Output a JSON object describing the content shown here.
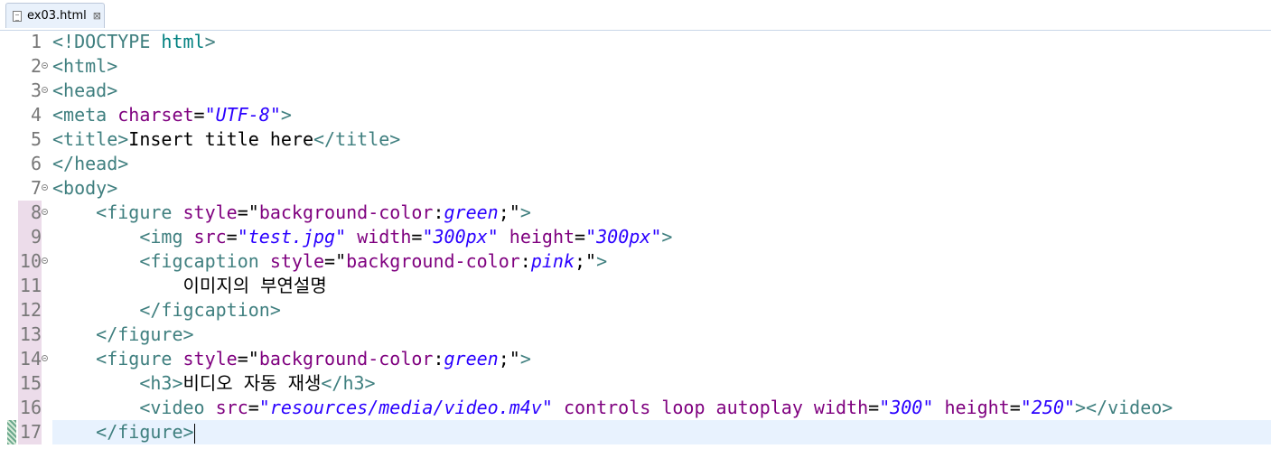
{
  "tab": {
    "title": "ex03.html",
    "close_glyph": "⊠"
  },
  "lines": [
    {
      "n": "1",
      "tokens": [
        [
          "t",
          "<!DOCTYPE "
        ],
        [
          "kw",
          "html"
        ],
        [
          "t",
          ">"
        ]
      ]
    },
    {
      "n": "2",
      "fold": true,
      "tokens": [
        [
          "t",
          "<html>"
        ]
      ]
    },
    {
      "n": "3",
      "fold": true,
      "tokens": [
        [
          "t",
          "<head>"
        ]
      ]
    },
    {
      "n": "4",
      "tokens": [
        [
          "t",
          "<meta "
        ],
        [
          "a",
          "charset"
        ],
        [
          "s",
          "="
        ],
        [
          "v",
          "\"UTF-8\""
        ],
        [
          "t",
          ">"
        ]
      ]
    },
    {
      "n": "5",
      "tokens": [
        [
          "t",
          "<title>"
        ],
        [
          "s",
          "Insert title here"
        ],
        [
          "t",
          "</title>"
        ]
      ]
    },
    {
      "n": "6",
      "tokens": [
        [
          "t",
          "</head>"
        ]
      ]
    },
    {
      "n": "7",
      "fold": true,
      "tokens": [
        [
          "t",
          "<body>"
        ]
      ]
    },
    {
      "n": "8",
      "fold": true,
      "mark": true,
      "tokens": [
        [
          "s",
          "    "
        ],
        [
          "t",
          "<figure "
        ],
        [
          "a",
          "style"
        ],
        [
          "s",
          "=\""
        ],
        [
          "a",
          "background-color"
        ],
        [
          "s",
          ":"
        ],
        [
          "v",
          "green"
        ],
        [
          "s",
          ";\""
        ],
        [
          "t",
          ">"
        ]
      ]
    },
    {
      "n": "9",
      "mark": true,
      "tokens": [
        [
          "s",
          "        "
        ],
        [
          "t",
          "<img "
        ],
        [
          "a",
          "src"
        ],
        [
          "s",
          "="
        ],
        [
          "v",
          "\"test.jpg\""
        ],
        [
          "s",
          " "
        ],
        [
          "a",
          "width"
        ],
        [
          "s",
          "="
        ],
        [
          "v",
          "\"300px\""
        ],
        [
          "s",
          " "
        ],
        [
          "a",
          "height"
        ],
        [
          "s",
          "="
        ],
        [
          "v",
          "\"300px\""
        ],
        [
          "t",
          ">"
        ]
      ]
    },
    {
      "n": "10",
      "fold": true,
      "mark": true,
      "tokens": [
        [
          "s",
          "        "
        ],
        [
          "t",
          "<figcaption "
        ],
        [
          "a",
          "style"
        ],
        [
          "s",
          "=\""
        ],
        [
          "a",
          "background-color"
        ],
        [
          "s",
          ":"
        ],
        [
          "v",
          "pink"
        ],
        [
          "s",
          ";\""
        ],
        [
          "t",
          ">"
        ]
      ]
    },
    {
      "n": "11",
      "mark": true,
      "tokens": [
        [
          "s",
          "            이미지의 부연설명"
        ]
      ]
    },
    {
      "n": "12",
      "mark": true,
      "tokens": [
        [
          "s",
          "        "
        ],
        [
          "t",
          "</figcaption>"
        ]
      ]
    },
    {
      "n": "13",
      "mark": true,
      "tokens": [
        [
          "s",
          "    "
        ],
        [
          "t",
          "</figure>"
        ]
      ]
    },
    {
      "n": "14",
      "fold": true,
      "mark": true,
      "tokens": [
        [
          "s",
          "    "
        ],
        [
          "t",
          "<figure "
        ],
        [
          "a",
          "style"
        ],
        [
          "s",
          "=\""
        ],
        [
          "a",
          "background-color"
        ],
        [
          "s",
          ":"
        ],
        [
          "v",
          "green"
        ],
        [
          "s",
          ";\""
        ],
        [
          "t",
          ">"
        ]
      ]
    },
    {
      "n": "15",
      "mark": true,
      "tokens": [
        [
          "s",
          "        "
        ],
        [
          "t",
          "<h3>"
        ],
        [
          "s",
          "비디오 자동 재생"
        ],
        [
          "t",
          "</h3>"
        ]
      ]
    },
    {
      "n": "16",
      "mark": true,
      "tokens": [
        [
          "s",
          "        "
        ],
        [
          "t",
          "<video "
        ],
        [
          "a",
          "src"
        ],
        [
          "s",
          "="
        ],
        [
          "v",
          "\"resources/media/video.m4v\""
        ],
        [
          "s",
          " "
        ],
        [
          "a",
          "controls"
        ],
        [
          "s",
          " "
        ],
        [
          "a",
          "loop"
        ],
        [
          "s",
          " "
        ],
        [
          "a",
          "autoplay"
        ],
        [
          "s",
          " "
        ],
        [
          "a",
          "width"
        ],
        [
          "s",
          "="
        ],
        [
          "v",
          "\"300\""
        ],
        [
          "s",
          " "
        ],
        [
          "a",
          "height"
        ],
        [
          "s",
          "="
        ],
        [
          "v",
          "\"250\""
        ],
        [
          "t",
          "></video>"
        ]
      ]
    },
    {
      "n": "17",
      "mark": true,
      "current": true,
      "diff": true,
      "caret": true,
      "tokens": [
        [
          "s",
          "    "
        ],
        [
          "t",
          "</figure>"
        ]
      ]
    }
  ]
}
